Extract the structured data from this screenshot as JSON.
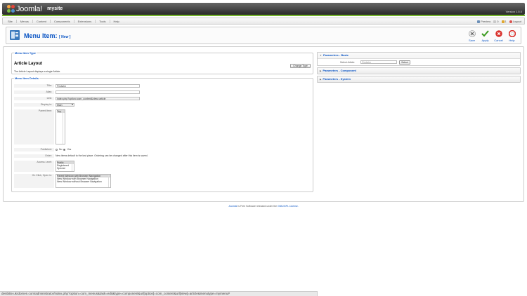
{
  "header": {
    "logo_text": "Joomla!",
    "site_name": "mysite",
    "version": "Version 1.5.0"
  },
  "menubar": {
    "items": [
      "Site",
      "Menus",
      "Content",
      "Components",
      "Extensions",
      "Tools",
      "Help"
    ],
    "preview": "Preview",
    "messages_count": "0",
    "users_count": "1",
    "logout": "Logout"
  },
  "toolbar": {
    "title": "Menu Item:",
    "title_suffix": "[ New ]",
    "buttons": {
      "save": "Save",
      "apply": "Apply",
      "cancel": "Cancel",
      "help": "Help"
    }
  },
  "menu_item_type": {
    "legend": "Menu Item Type",
    "layout_title": "Article Layout",
    "description": "The Article Layout displays a single Article.",
    "change_type": "Change Type"
  },
  "details": {
    "legend": "Menu Item Details",
    "title_label": "Title:",
    "title_value": "Firstwim",
    "alias_label": "Alias:",
    "alias_value": "",
    "link_label": "Link:",
    "link_value": "index.php?option=com_content&view=article",
    "display_label": "Display in:",
    "display_value": "Main",
    "parent_label": "Parent Item:",
    "parent_value": "Top",
    "published_label": "Published:",
    "published_no": "No",
    "published_yes": "Yes",
    "order_label": "Order:",
    "order_text": "New items default to the last place. Ordering can be changed after this item is saved.",
    "access_label": "Access Level:",
    "access_options": [
      "Public",
      "Registered",
      "Special"
    ],
    "onclick_label": "On Click, Open in:",
    "onclick_options": [
      "Parent Window with Browser Navigation",
      "New Window with Browser Navigation",
      "New Window without Browser Navigation"
    ]
  },
  "panels": {
    "basic": "Parameters - Basic",
    "select_article_label": "Select Article:",
    "select_article_value": "Firstwim",
    "select_button": "Select",
    "component": "Parameters - Component",
    "system": "Parameters - System"
  },
  "footer": {
    "joomla": "Joomla!",
    "text": "is Free Software released under the",
    "license": "GNU/GPL License."
  },
  "statusbar": {
    "url": "denbitte.ukrdomen.com/administrator/index.php?option=com_menus&task=edit&type=component&url[option]=com_content&url[view]=article&menutype=mymenu#"
  },
  "colors": {
    "accent": "#0b55c4",
    "header_green": "#74b42b"
  }
}
